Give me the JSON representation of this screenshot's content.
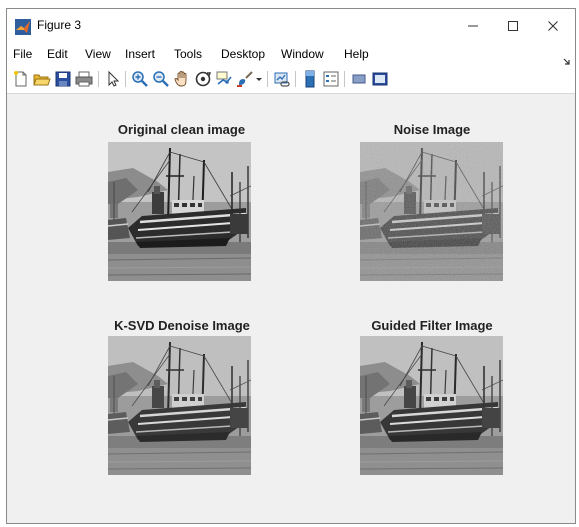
{
  "window": {
    "title": "Figure 3",
    "minimize_glyph": "—",
    "maximize_glyph": "☐",
    "close_glyph": "✕"
  },
  "menu": [
    "File",
    "Edit",
    "View",
    "Insert",
    "Tools",
    "Desktop",
    "Window",
    "Help"
  ],
  "toolbar_icons": [
    "new-figure-icon",
    "open-file-icon",
    "save-icon",
    "print-icon",
    "pointer-icon",
    "zoom-in-icon",
    "zoom-out-icon",
    "pan-icon",
    "rotate-3d-icon",
    "data-cursor-icon",
    "brush-icon",
    "brush-dropdown-icon",
    "link-plot-icon",
    "colorbar-icon",
    "legend-icon",
    "hide-plot-tools-icon",
    "show-plot-tools-icon"
  ],
  "axes": [
    {
      "title": "Original clean image",
      "noise": 0.0
    },
    {
      "title": "Noise Image",
      "noise": 1.0
    },
    {
      "title": "K-SVD Denoise Image",
      "noise": 0.0
    },
    {
      "title": "Guided Filter Image",
      "noise": 0.0
    }
  ],
  "colors": {
    "canvas": "#f0f0f0",
    "matlab_icon": "#c8501e",
    "toolbar_blue": "#2b6fb5"
  }
}
